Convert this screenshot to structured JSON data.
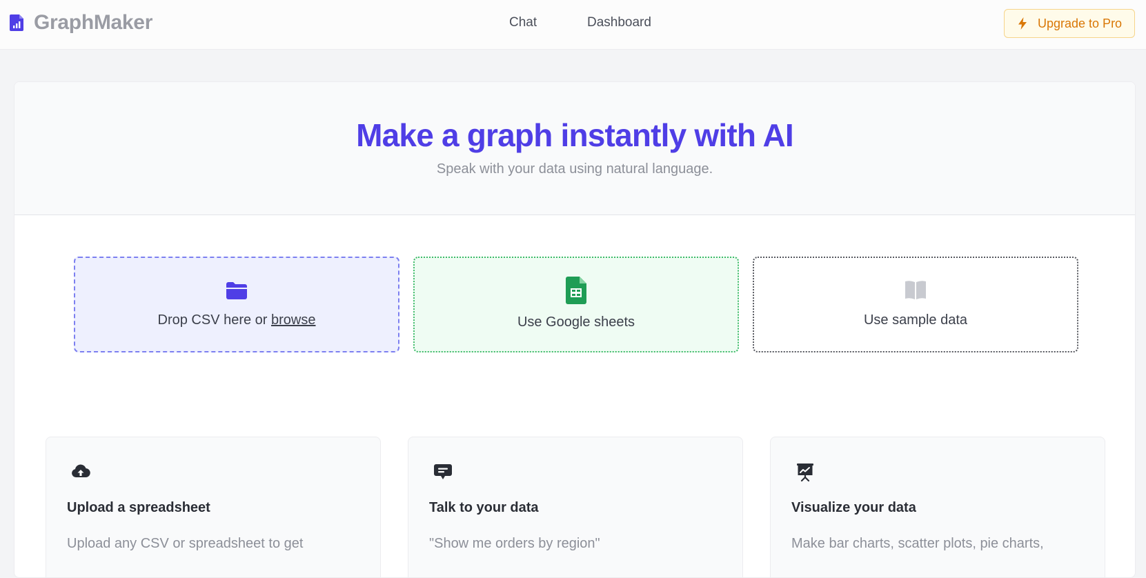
{
  "header": {
    "brand": "GraphMaker",
    "nav": [
      {
        "label": "Chat"
      },
      {
        "label": "Dashboard"
      }
    ],
    "upgrade_label": "Upgrade to Pro"
  },
  "hero": {
    "title": "Make a graph instantly with AI",
    "subtitle": "Speak with your data using natural language."
  },
  "sources": {
    "csv": {
      "prefix": "Drop CSV here or ",
      "link": "browse",
      "icon": "folder-icon"
    },
    "sheets": {
      "label": "Use Google sheets",
      "icon": "google-sheets-icon"
    },
    "sample": {
      "label": "Use sample data",
      "icon": "book-icon"
    }
  },
  "features": [
    {
      "icon": "cloud-upload-icon",
      "title": "Upload a spreadsheet",
      "desc": "Upload any CSV or spreadsheet to get"
    },
    {
      "icon": "chat-bubble-icon",
      "title": "Talk to your data",
      "desc": "\"Show me orders by region\""
    },
    {
      "icon": "presentation-chart-icon",
      "title": "Visualize your data",
      "desc": "Make bar charts, scatter plots, pie charts,"
    }
  ],
  "colors": {
    "accent": "#4f3ee6",
    "upgrade": "#d97706",
    "sheets_green": "#1f9d55"
  }
}
